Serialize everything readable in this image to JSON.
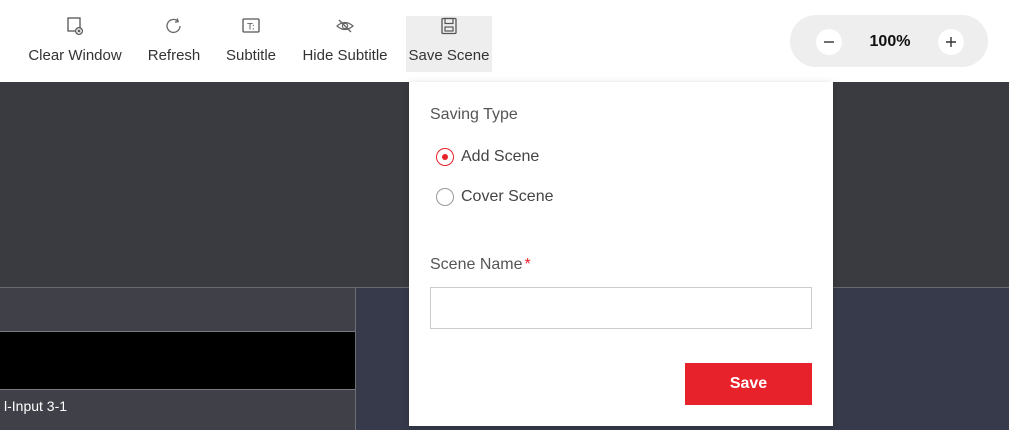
{
  "toolbar": {
    "tools": [
      {
        "label": "Clear Window",
        "icon": "clear-window-icon"
      },
      {
        "label": "Refresh",
        "icon": "refresh-icon"
      },
      {
        "label": "Subtitle",
        "icon": "subtitle-icon"
      },
      {
        "label": "Hide Subtitle",
        "icon": "hide-subtitle-icon"
      },
      {
        "label": "Save Scene",
        "icon": "save-scene-icon",
        "active": true
      }
    ],
    "zoom": {
      "value": "100%",
      "minus": "−",
      "plus": "+"
    }
  },
  "canvas": {
    "window_label": "l-Input 3-1"
  },
  "save_popover": {
    "saving_type_label": "Saving Type",
    "options": [
      {
        "label": "Add Scene",
        "checked": true
      },
      {
        "label": "Cover Scene",
        "checked": false
      }
    ],
    "scene_name_label": "Scene Name",
    "required_mark": "*",
    "scene_name_value": "",
    "save_label": "Save"
  },
  "colors": {
    "accent": "#e8222a",
    "canvas_bg": "#3a3b40",
    "zoom_bg": "#eeeeee"
  }
}
